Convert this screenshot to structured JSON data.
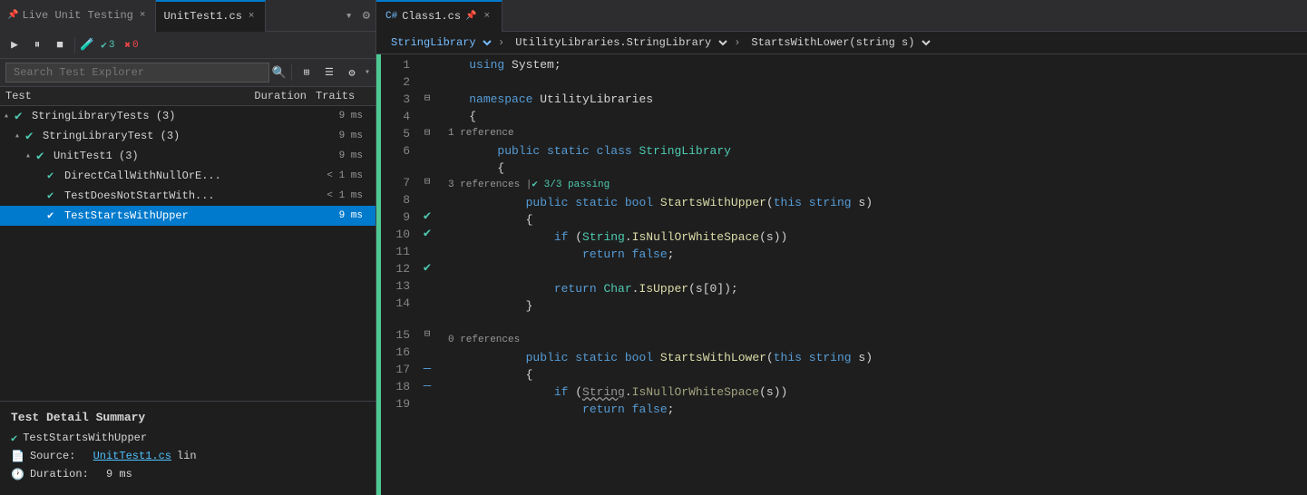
{
  "tabs": {
    "left": [
      {
        "id": "lut",
        "label": "Live Unit Testing",
        "pinned": true,
        "active": false,
        "closable": true
      },
      {
        "id": "unittest1",
        "label": "UnitTest1.cs",
        "active": true,
        "closable": true
      }
    ],
    "right": [
      {
        "id": "class1",
        "label": "Class1.cs",
        "active": true,
        "closable": true
      }
    ]
  },
  "lut_toolbar": {
    "play_label": "▶",
    "pause_label": "⏸",
    "stop_label": "■",
    "flask_label": "🧪",
    "pass_count": "3",
    "pass_icon": "✔",
    "fail_count": "0",
    "fail_icon": "✖",
    "title": "Live Unit Testing"
  },
  "test_explorer": {
    "search_placeholder": "Search Test Explorer",
    "columns": {
      "test": "Test",
      "duration": "Duration",
      "traits": "Traits"
    },
    "tree": [
      {
        "id": "root",
        "indent": 0,
        "expand": "▴",
        "label": "StringLibraryTests (3)",
        "duration": "9 ms",
        "pass": true
      },
      {
        "id": "lib",
        "indent": 1,
        "expand": "▴",
        "label": "StringLibraryTest (3)",
        "duration": "9 ms",
        "pass": true
      },
      {
        "id": "unit",
        "indent": 2,
        "expand": "▴",
        "label": "UnitTest1 (3)",
        "duration": "9 ms",
        "pass": true
      },
      {
        "id": "test1",
        "indent": 3,
        "expand": "",
        "label": "DirectCallWithNullOrE...",
        "duration": "< 1 ms",
        "pass": true
      },
      {
        "id": "test2",
        "indent": 3,
        "expand": "",
        "label": "TestDoesNotStartWith...",
        "duration": "< 1 ms",
        "pass": true
      },
      {
        "id": "test3",
        "indent": 3,
        "expand": "",
        "label": "TestStartsWithUpper",
        "duration": "9 ms",
        "pass": true,
        "selected": true
      }
    ],
    "detail": {
      "title": "Test Detail Summary",
      "test_name": "TestStartsWithUpper",
      "source_label": "Source:",
      "source_file": "UnitTest1.cs",
      "source_suffix": "lin",
      "duration_label": "Duration:",
      "duration_value": "9 ms"
    }
  },
  "editor": {
    "breadcrumbs": {
      "namespace_icon": "🔷",
      "namespace": "StringLibrary",
      "class_icon": "⚡",
      "class_ns": "UtilityLibraries.StringLibrary",
      "method_icon": "🔷",
      "method": "StartsWithLower(string s)"
    },
    "lines": [
      {
        "num": 1,
        "gutter": "",
        "code": [
          {
            "t": "    ",
            "c": ""
          },
          {
            "t": "using",
            "c": "kw"
          },
          {
            "t": " System;",
            "c": ""
          }
        ]
      },
      {
        "num": 2,
        "gutter": "",
        "code": []
      },
      {
        "num": 3,
        "gutter": "collapse",
        "code": [
          {
            "t": "    ",
            "c": ""
          },
          {
            "t": "namespace",
            "c": "kw"
          },
          {
            "t": " UtilityLibraries",
            "c": ""
          }
        ]
      },
      {
        "num": 4,
        "gutter": "",
        "code": [
          {
            "t": "    {",
            "c": ""
          }
        ]
      },
      {
        "num": 5,
        "gutter": "collapse",
        "code": [
          {
            "t": "        ",
            "c": ""
          },
          {
            "t": "public",
            "c": "kw"
          },
          {
            "t": " ",
            "c": ""
          },
          {
            "t": "static",
            "c": "kw"
          },
          {
            "t": " ",
            "c": ""
          },
          {
            "t": "class",
            "c": "kw"
          },
          {
            "t": " ",
            "c": ""
          },
          {
            "t": "StringLibrary",
            "c": "type"
          }
        ]
      },
      {
        "num": 6,
        "gutter": "",
        "code": [
          {
            "t": "        {",
            "c": ""
          }
        ]
      },
      {
        "num": "7a",
        "gutter": "",
        "code": [],
        "ref": "3 references | ✔ 3/3 passing"
      },
      {
        "num": 7,
        "gutter": "collapse_check",
        "code": [
          {
            "t": "            ",
            "c": ""
          },
          {
            "t": "public",
            "c": "kw"
          },
          {
            "t": " ",
            "c": ""
          },
          {
            "t": "static",
            "c": "kw"
          },
          {
            "t": " ",
            "c": ""
          },
          {
            "t": "bool",
            "c": "kw"
          },
          {
            "t": " ",
            "c": ""
          },
          {
            "t": "StartsWithUpper",
            "c": "method"
          },
          {
            "t": "(",
            "c": ""
          },
          {
            "t": "this",
            "c": "kw"
          },
          {
            "t": " ",
            "c": ""
          },
          {
            "t": "string",
            "c": "kw"
          },
          {
            "t": " s)",
            "c": ""
          }
        ]
      },
      {
        "num": 8,
        "gutter": "",
        "code": [
          {
            "t": "            {",
            "c": ""
          }
        ]
      },
      {
        "num": 9,
        "gutter": "check",
        "code": [
          {
            "t": "                ",
            "c": ""
          },
          {
            "t": "if",
            "c": "kw"
          },
          {
            "t": " (",
            "c": ""
          },
          {
            "t": "String",
            "c": "type"
          },
          {
            "t": ".",
            "c": ""
          },
          {
            "t": "IsNullOrWhiteSpace",
            "c": "method"
          },
          {
            "t": "(s))",
            "c": ""
          }
        ]
      },
      {
        "num": 10,
        "gutter": "check",
        "code": [
          {
            "t": "                    ",
            "c": ""
          },
          {
            "t": "return",
            "c": "kw"
          },
          {
            "t": " ",
            "c": ""
          },
          {
            "t": "false",
            "c": "kw"
          },
          {
            "t": ";",
            "c": ""
          }
        ]
      },
      {
        "num": 11,
        "gutter": "",
        "code": []
      },
      {
        "num": 12,
        "gutter": "check",
        "code": [
          {
            "t": "                ",
            "c": ""
          },
          {
            "t": "return",
            "c": "kw"
          },
          {
            "t": " ",
            "c": ""
          },
          {
            "t": "Char",
            "c": "type"
          },
          {
            "t": ".",
            "c": ""
          },
          {
            "t": "IsUpper",
            "c": "method"
          },
          {
            "t": "(s[0]);",
            "c": ""
          }
        ]
      },
      {
        "num": 13,
        "gutter": "",
        "code": [
          {
            "t": "            }",
            "c": ""
          }
        ]
      },
      {
        "num": 14,
        "gutter": "",
        "code": []
      },
      {
        "num": "15a",
        "gutter": "",
        "code": [],
        "ref": "0 references"
      },
      {
        "num": 15,
        "gutter": "collapse_dash",
        "code": [
          {
            "t": "            ",
            "c": ""
          },
          {
            "t": "public",
            "c": "kw"
          },
          {
            "t": " ",
            "c": ""
          },
          {
            "t": "static",
            "c": "kw"
          },
          {
            "t": " ",
            "c": ""
          },
          {
            "t": "bool",
            "c": "kw"
          },
          {
            "t": " ",
            "c": ""
          },
          {
            "t": "StartsWithLower",
            "c": "method"
          },
          {
            "t": "(",
            "c": ""
          },
          {
            "t": "this",
            "c": "kw"
          },
          {
            "t": " ",
            "c": ""
          },
          {
            "t": "string",
            "c": "kw"
          },
          {
            "t": " s)",
            "c": ""
          }
        ]
      },
      {
        "num": 16,
        "gutter": "",
        "code": [
          {
            "t": "            {",
            "c": ""
          }
        ]
      },
      {
        "num": 17,
        "gutter": "dash_warn",
        "code": [
          {
            "t": "                ",
            "c": ""
          },
          {
            "t": "if",
            "c": "kw"
          },
          {
            "t": " (",
            "c": ""
          },
          {
            "t": "String",
            "c": "type_dim"
          },
          {
            "t": ".",
            "c": ""
          },
          {
            "t": "IsNullOrWhiteSpace",
            "c": "method_dim"
          },
          {
            "t": "(s))",
            "c": ""
          }
        ]
      },
      {
        "num": 18,
        "gutter": "dash",
        "code": [
          {
            "t": "                    ",
            "c": ""
          },
          {
            "t": "return",
            "c": "kw"
          },
          {
            "t": " ",
            "c": ""
          },
          {
            "t": "false",
            "c": "kw"
          },
          {
            "t": ";",
            "c": ""
          }
        ]
      },
      {
        "num": 19,
        "gutter": "",
        "code": []
      }
    ]
  }
}
